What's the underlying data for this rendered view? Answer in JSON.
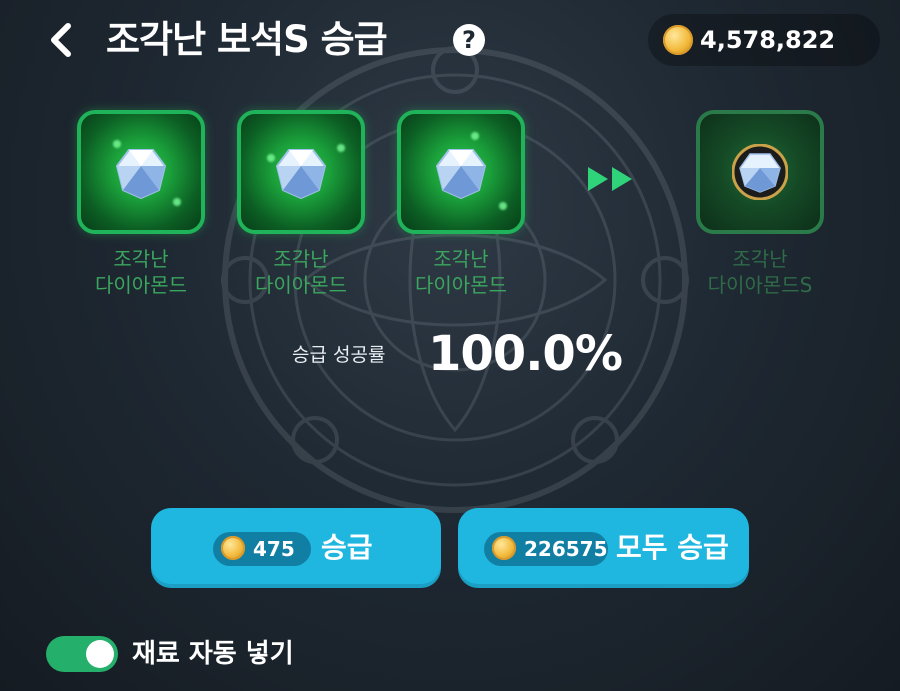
{
  "header": {
    "title": "조각난 보석S 승급",
    "help_glyph": "?",
    "currency": {
      "icon": "gold-coin-icon",
      "value": "4,578,822"
    }
  },
  "materials": [
    {
      "label_line1": "조각난",
      "label_line2": "다이아몬드",
      "icon": "diamond-gem-icon"
    },
    {
      "label_line1": "조각난",
      "label_line2": "다이아몬드",
      "icon": "diamond-gem-icon"
    },
    {
      "label_line1": "조각난",
      "label_line2": "다이아몬드",
      "icon": "diamond-gem-icon"
    }
  ],
  "result": {
    "label_line1": "조각난",
    "label_line2": "다이아몬드S",
    "icon": "diamond-gem-s-icon"
  },
  "success": {
    "label": "승급 성공률",
    "value": "100.0%"
  },
  "buttons": {
    "upgrade": {
      "cost": "475",
      "label": "승급"
    },
    "upgrade_all": {
      "cost": "226575",
      "label": "모두 승급"
    }
  },
  "auto_fill": {
    "label": "재료 자동 넣기",
    "enabled": true
  },
  "colors": {
    "accent_button": "#1fb6e0",
    "slot_green": "#1a9e3a",
    "toggle_on": "#24b06a"
  }
}
